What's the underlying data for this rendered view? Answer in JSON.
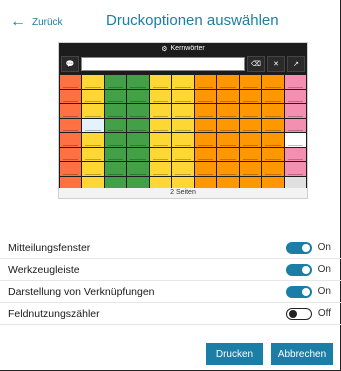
{
  "header": {
    "back_label": "Zurück",
    "title": "Druckoptionen auswählen"
  },
  "preview": {
    "vocab_name": "Kernwörter",
    "message_cells": [
      "Sprechen",
      "Löschen",
      "Wort löschen",
      "Teilen"
    ],
    "caption": "2 Seiten",
    "grid_colors": [
      "#ff7043",
      "#fdd835",
      "#43a047",
      "#43a047",
      "#fdd835",
      "#fdd835",
      "#ff9800",
      "#ff9800",
      "#ff9800",
      "#ff9800",
      "#f48fb1",
      "#ff7043",
      "#fdd835",
      "#43a047",
      "#43a047",
      "#fdd835",
      "#fdd835",
      "#ff9800",
      "#ff9800",
      "#ff9800",
      "#ff9800",
      "#f48fb1",
      "#ff7043",
      "#fdd835",
      "#43a047",
      "#43a047",
      "#fdd835",
      "#fdd835",
      "#ff9800",
      "#ff9800",
      "#ff9800",
      "#ff9800",
      "#f48fb1",
      "#ff7043",
      "#e3f2fd",
      "#43a047",
      "#43a047",
      "#fdd835",
      "#fdd835",
      "#ff9800",
      "#ff9800",
      "#ff9800",
      "#ff9800",
      "#f48fb1",
      "#ff7043",
      "#fdd835",
      "#43a047",
      "#43a047",
      "#fdd835",
      "#fdd835",
      "#ff9800",
      "#ff9800",
      "#ff9800",
      "#ff9800",
      "#ffffff",
      "#ff7043",
      "#fdd835",
      "#43a047",
      "#43a047",
      "#fdd835",
      "#fdd835",
      "#ff9800",
      "#ff9800",
      "#ff9800",
      "#ff9800",
      "#f48fb1",
      "#ff7043",
      "#fdd835",
      "#43a047",
      "#43a047",
      "#fdd835",
      "#fdd835",
      "#ff9800",
      "#ff9800",
      "#ff9800",
      "#ff9800",
      "#f48fb1",
      "#ff7043",
      "#fdd835",
      "#43a047",
      "#43a047",
      "#fdd835",
      "#fdd835",
      "#ff9800",
      "#ff9800",
      "#ff9800",
      "#ff9800",
      "#e0e0e0",
      "#29b6f6",
      "#29b6f6",
      "#29b6f6",
      "#29b6f6",
      "#29b6f6",
      "#29b6f6",
      "#29b6f6",
      "#29b6f6",
      "#29b6f6",
      "#29b6f6",
      "#bdbdbd"
    ]
  },
  "options": [
    {
      "label": "Mitteilungsfenster",
      "state": "On",
      "on": true
    },
    {
      "label": "Werkzeugleiste",
      "state": "On",
      "on": true
    },
    {
      "label": "Darstellung von Verknüpfungen",
      "state": "On",
      "on": true
    },
    {
      "label": "Feldnutzungszähler",
      "state": "Off",
      "on": false
    }
  ],
  "buttons": {
    "print": "Drucken",
    "cancel": "Abbrechen"
  },
  "colors": {
    "accent": "#1b7ea6"
  }
}
